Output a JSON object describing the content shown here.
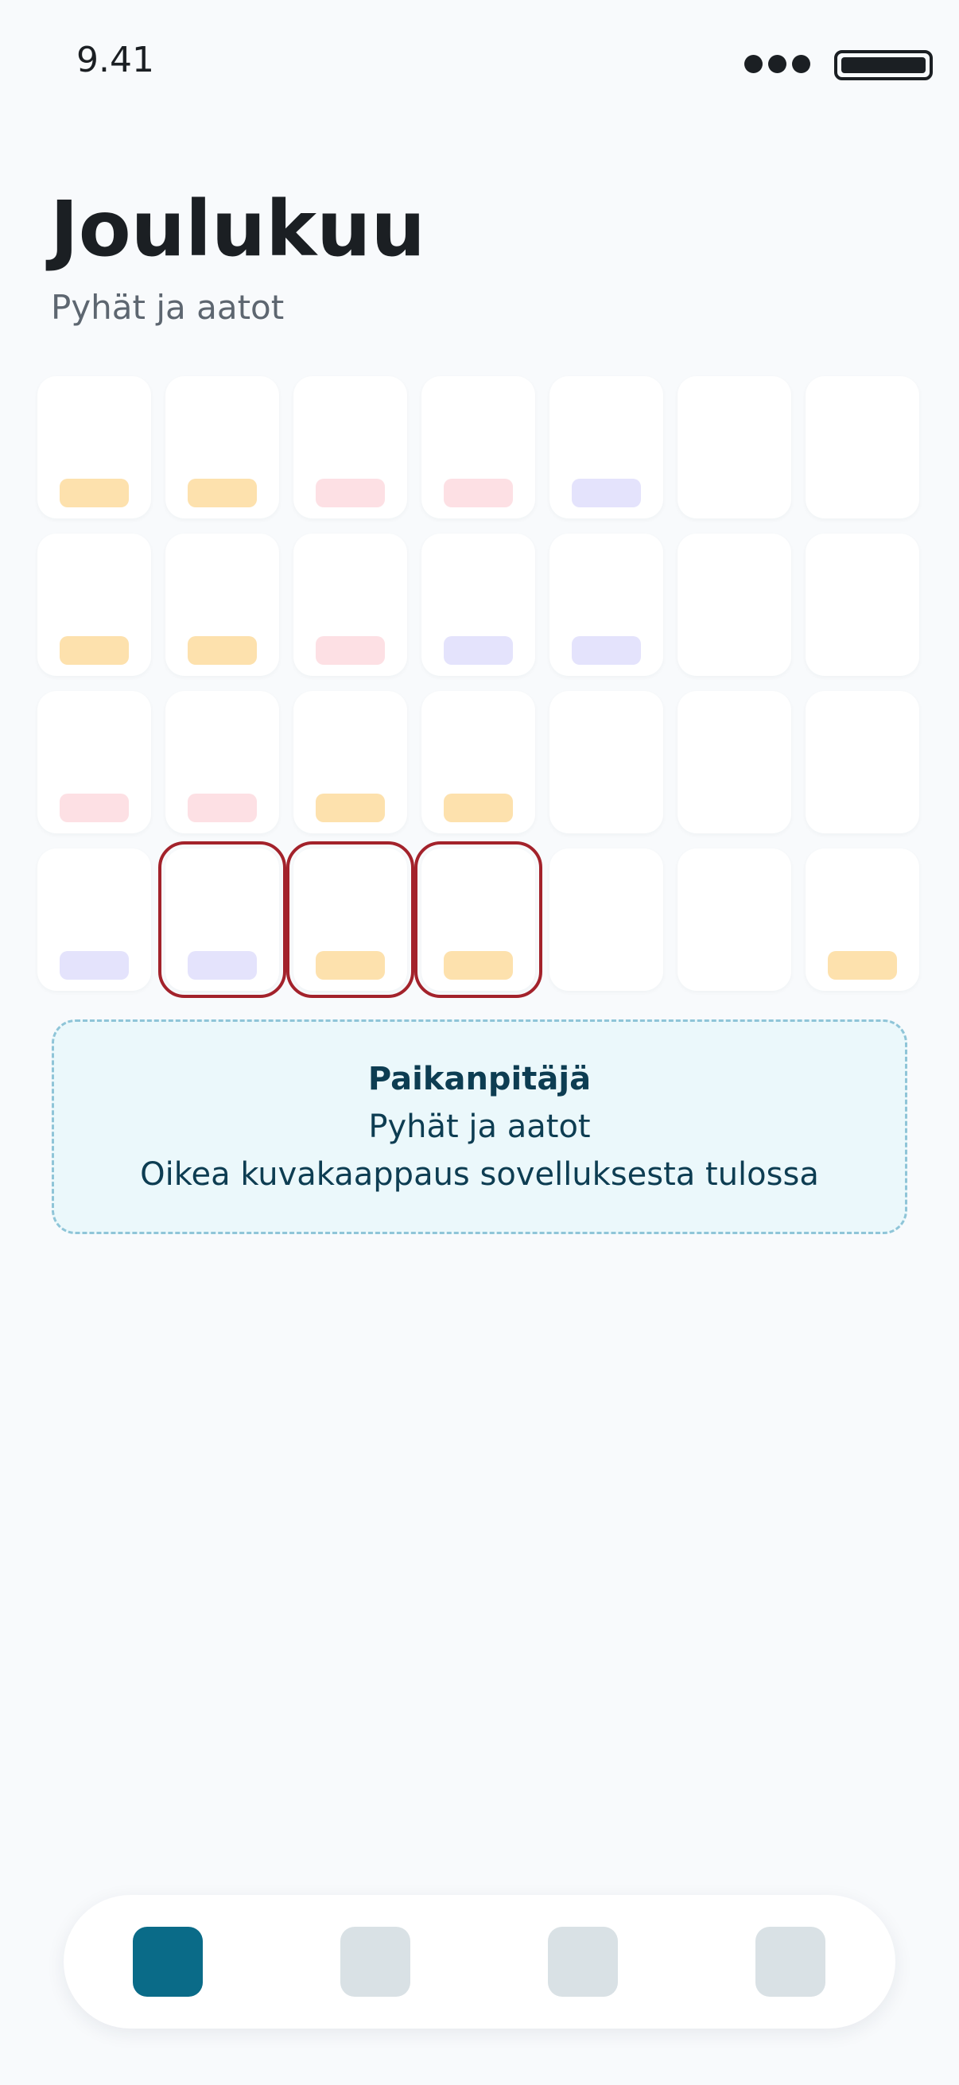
{
  "status_bar": {
    "time": "9.41",
    "signal_icon": "signal-dots-icon",
    "battery_icon": "battery-icon"
  },
  "header": {
    "title": "Joulukuu",
    "subtitle": "Pyhät ja aatot"
  },
  "colors": {
    "orange": "#fde1ad",
    "pink": "#fde0e4",
    "lavender": "#e4e3fc",
    "selected_border": "#a3222b",
    "accent": "#0a6b88"
  },
  "calendar": {
    "weeks": [
      [
        {
          "event": "orange"
        },
        {
          "event": "orange"
        },
        {
          "event": "pink"
        },
        {
          "event": "pink"
        },
        {
          "event": "lavender"
        },
        {
          "event": null
        },
        {
          "event": null
        }
      ],
      [
        {
          "event": "orange"
        },
        {
          "event": "orange"
        },
        {
          "event": "pink"
        },
        {
          "event": "lavender"
        },
        {
          "event": "lavender"
        },
        {
          "event": null
        },
        {
          "event": null
        }
      ],
      [
        {
          "event": "pink"
        },
        {
          "event": "pink"
        },
        {
          "event": "orange"
        },
        {
          "event": "orange"
        },
        {
          "event": null
        },
        {
          "event": null
        },
        {
          "event": null
        }
      ],
      [
        {
          "event": "lavender"
        },
        {
          "event": "lavender",
          "selected": true
        },
        {
          "event": "orange",
          "selected": true
        },
        {
          "event": "orange",
          "selected": true
        },
        {
          "event": null
        },
        {
          "event": null
        },
        {
          "event": "orange"
        }
      ]
    ]
  },
  "placeholder": {
    "title": "Paikanpitäjä",
    "line1": "Pyhät ja aatot",
    "line2": "Oikea kuvakaappaus sovelluksesta tulossa"
  },
  "bottom_nav": {
    "tabs": [
      {
        "name": "nav-tab-1",
        "active": true
      },
      {
        "name": "nav-tab-2",
        "active": false
      },
      {
        "name": "nav-tab-3",
        "active": false
      },
      {
        "name": "nav-tab-4",
        "active": false
      }
    ]
  }
}
